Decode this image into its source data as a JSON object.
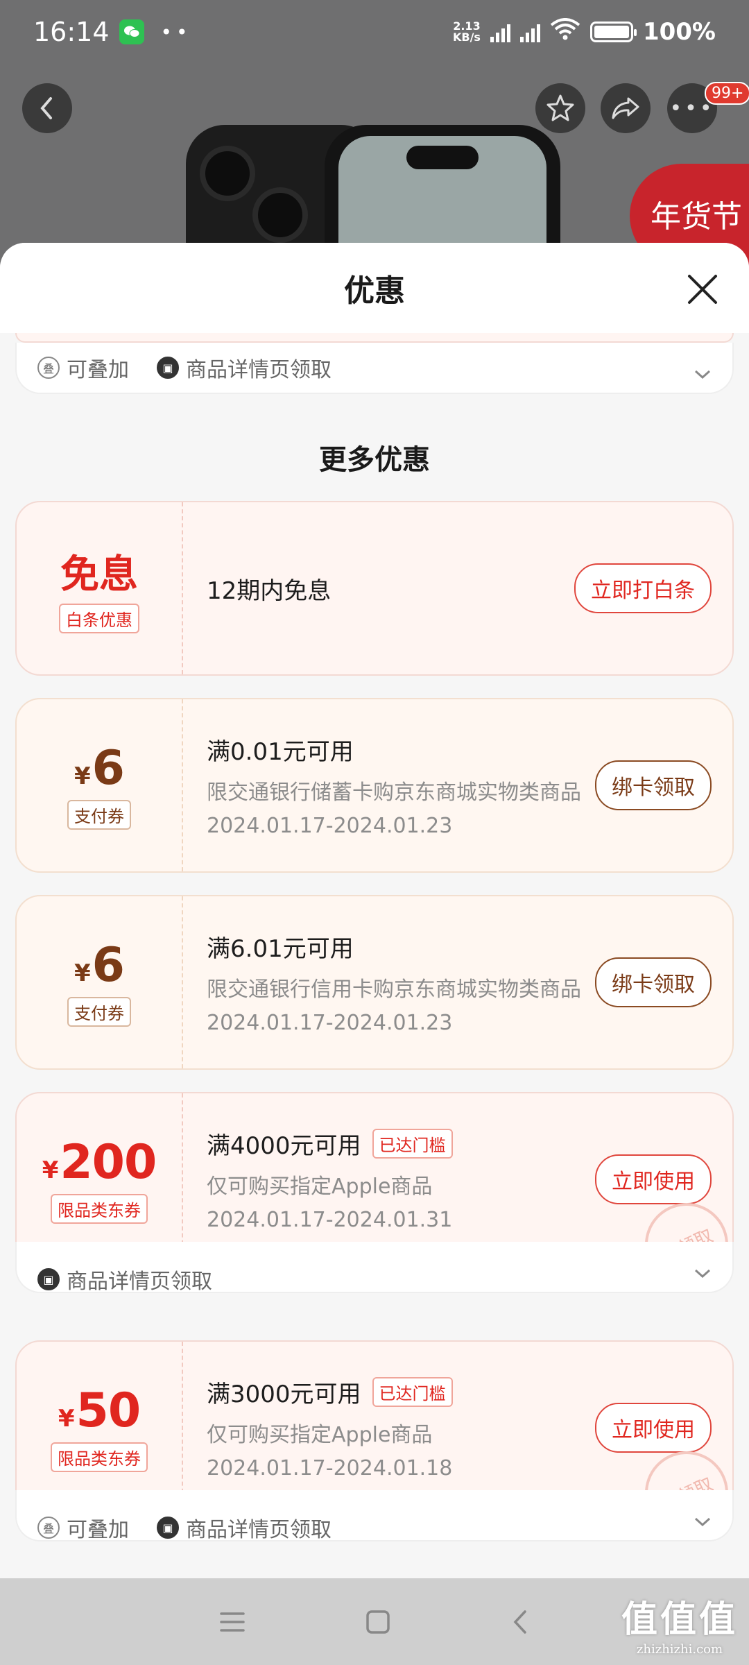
{
  "status_bar": {
    "time": "16:14",
    "network_speed": "2.13\nKB/s",
    "battery": "100%"
  },
  "header_badge": "99+",
  "festival_text": "年货节",
  "sheet": {
    "title": "优惠"
  },
  "top_card_footer": {
    "stackable": "可叠加",
    "detail_page_claim": "商品详情页领取"
  },
  "more_offers_title": "更多优惠",
  "offers": [
    {
      "big_word": "免息",
      "tag": "白条优惠",
      "line1": "12期内免息",
      "action": "立即打白条"
    },
    {
      "yen": "¥",
      "amount": "6",
      "tag": "支付券",
      "line1": "满0.01元可用",
      "line2": "限交通银行储蓄卡购京东商城实物类商品",
      "line3": "2024.01.17-2024.01.23",
      "action": "绑卡领取"
    },
    {
      "yen": "¥",
      "amount": "6",
      "tag": "支付券",
      "line1": "满6.01元可用",
      "line2": "限交通银行信用卡购京东商城实物类商品",
      "line3": "2024.01.17-2024.01.23",
      "action": "绑卡领取"
    },
    {
      "yen": "¥",
      "amount": "200",
      "tag": "限品类东券",
      "line1": "满4000元可用",
      "reached": "已达门槛",
      "line2": "仅可购买指定Apple商品",
      "line3": "2024.01.17-2024.01.31",
      "action": "立即使用",
      "stamp": "已领取",
      "footer_claim": "商品详情页领取"
    },
    {
      "yen": "¥",
      "amount": "50",
      "tag": "限品类东券",
      "line1": "满3000元可用",
      "reached": "已达门槛",
      "line2": "仅可购买指定Apple商品",
      "line3": "2024.01.17-2024.01.18",
      "action": "立即使用",
      "stamp": "已领取",
      "footer_stackable": "可叠加",
      "footer_claim": "商品详情页领取"
    }
  ],
  "watermark": {
    "big": "值值值",
    "small": "zhizhizhi.com"
  }
}
